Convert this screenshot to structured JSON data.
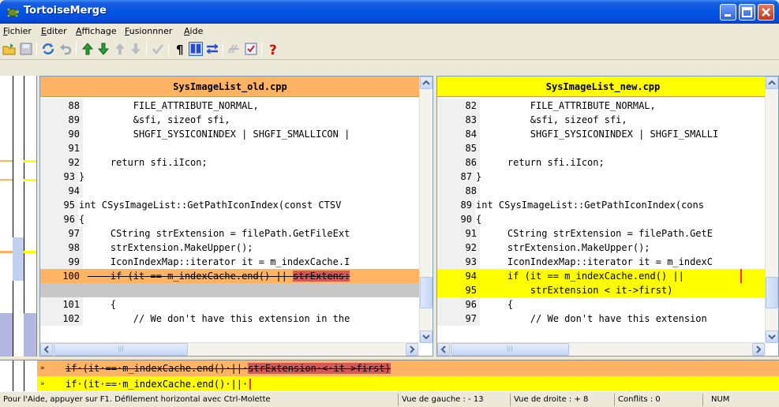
{
  "window": {
    "title": "TortoiseMerge"
  },
  "menu": [
    {
      "label": "Fichier",
      "u": "F",
      "rest": "ichier"
    },
    {
      "label": "Editer",
      "u": "E",
      "rest": "diter"
    },
    {
      "label": "Affichage",
      "u": "A",
      "rest": "ffichage"
    },
    {
      "label": "Fusionnner",
      "u": "F",
      "rest": "usionnner"
    },
    {
      "label": "Aide",
      "u": "A",
      "rest": "ide"
    }
  ],
  "toolbar": {
    "icons": [
      "open-icon",
      "save-icon",
      "reload-icon",
      "undo-icon",
      "prev-diff-icon",
      "next-diff-icon",
      "prev-conflict-icon",
      "next-conflict-icon",
      "use-block-icon",
      "whitespace-icon",
      "one-pane-view-icon",
      "two-pane-view-icon",
      "patch-icon",
      "mark-resolved-icon",
      "help-icon"
    ]
  },
  "left_pane": {
    "filename": "SysImageList_old.cpp",
    "header_color": "#ffb463",
    "lines": [
      {
        "n": "88",
        "text": "        FILE_ATTRIBUTE_NORMAL,",
        "type": "normal"
      },
      {
        "n": "89",
        "text": "        &sfi, sizeof sfi,",
        "type": "normal"
      },
      {
        "n": "90",
        "text": "        SHGFI_SYSICONINDEX | SHGFI_SMALLICON |",
        "type": "normal"
      },
      {
        "n": "91",
        "text": "",
        "type": "normal"
      },
      {
        "n": "92",
        "text": "    return sfi.iIcon;",
        "type": "normal"
      },
      {
        "n": "93",
        "text": "}",
        "type": "brace"
      },
      {
        "n": "94",
        "text": "",
        "type": "normal"
      },
      {
        "n": "95",
        "text": "int CSysImageList::GetPathIconIndex(const CTSV",
        "type": "brace"
      },
      {
        "n": "96",
        "text": "{",
        "type": "brace"
      },
      {
        "n": "97",
        "text": "    CString strExtension = filePath.GetFileExt",
        "type": "normal"
      },
      {
        "n": "98",
        "text": "    strExtension.MakeUpper();",
        "type": "normal"
      },
      {
        "n": "99",
        "text": "    IconIndexMap::iterator it = m_indexCache.I",
        "type": "normal"
      },
      {
        "n": "100",
        "text_a": "    if (it == m_indexCache.end() || ",
        "text_b": "strExtens:",
        "type": "changed"
      },
      {
        "n": "",
        "text": "",
        "type": "empty"
      },
      {
        "n": "101",
        "text": "    {",
        "type": "normal"
      },
      {
        "n": "102",
        "text": "        // We don't have this extension in the",
        "type": "normal"
      }
    ]
  },
  "right_pane": {
    "filename": "SysImageList_new.cpp",
    "header_color": "#ffff00",
    "lines": [
      {
        "n": "82",
        "text": "        FILE_ATTRIBUTE_NORMAL,",
        "type": "normal"
      },
      {
        "n": "83",
        "text": "        &sfi, sizeof sfi,",
        "type": "normal"
      },
      {
        "n": "84",
        "text": "        SHGFI_SYSICONINDEX | SHGFI_SMALLI",
        "type": "normal"
      },
      {
        "n": "85",
        "text": "",
        "type": "normal"
      },
      {
        "n": "86",
        "text": "    return sfi.iIcon;",
        "type": "normal"
      },
      {
        "n": "87",
        "text": "}",
        "type": "brace"
      },
      {
        "n": "88",
        "text": "",
        "type": "normal"
      },
      {
        "n": "89",
        "text": "int CSysImageList::GetPathIconIndex(cons",
        "type": "brace"
      },
      {
        "n": "90",
        "text": "{",
        "type": "brace"
      },
      {
        "n": "91",
        "text": "    CString strExtension = filePath.GetE",
        "type": "normal"
      },
      {
        "n": "92",
        "text": "    strExtension.MakeUpper();",
        "type": "normal"
      },
      {
        "n": "93",
        "text": "    IconIndexMap::iterator it = m_indexC",
        "type": "normal"
      },
      {
        "n": "94",
        "text": "    if (it == m_indexCache.end() ||",
        "type": "added"
      },
      {
        "n": "95",
        "text": "        strExtension < it->first)",
        "type": "added"
      },
      {
        "n": "96",
        "text": "    {",
        "type": "normal"
      },
      {
        "n": "97",
        "text": "        // We don't have this extension",
        "type": "normal"
      }
    ]
  },
  "linediff": {
    "row1_marker": "»",
    "row1_text_a": "if·(it·==·m_indexCache.end()·||·",
    "row1_text_b": "strExtension·<·it->first)",
    "row2_marker": "»",
    "row2_text": "if·(it·==·m_indexCache.end()·||·"
  },
  "status": {
    "help": "Pour l'Aide, appuyer sur F1. Défilement horizontal avec Ctrl-Molette",
    "left_view": "Vue de gauche : - 13",
    "right_view": "Vue de droite : + 8",
    "conflicts": "Conflits : 0",
    "num": "NUM"
  }
}
